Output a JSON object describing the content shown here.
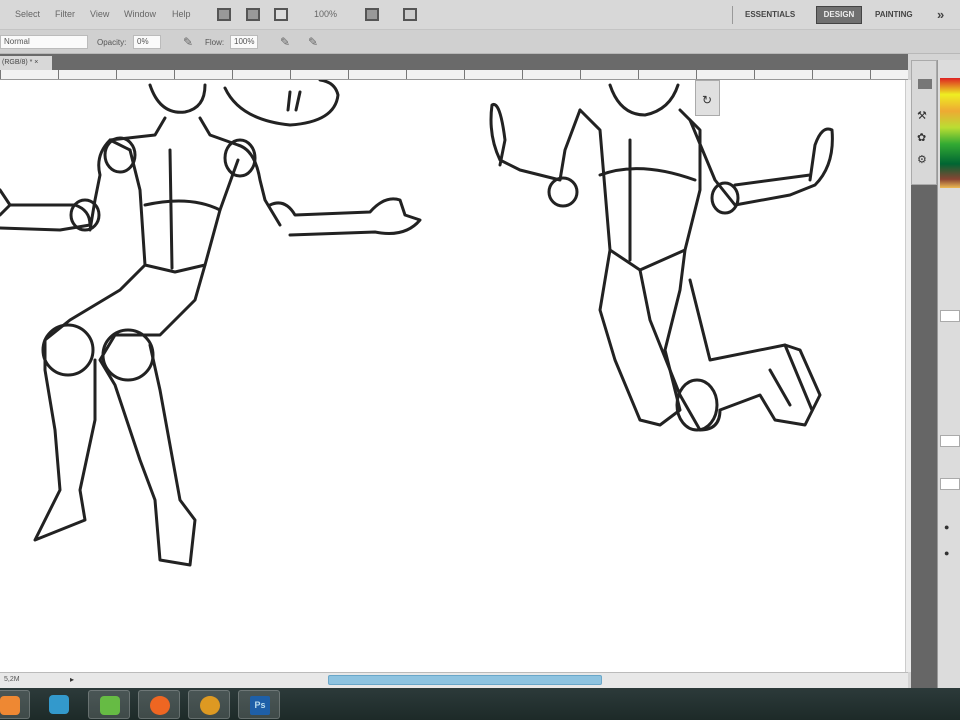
{
  "menubar": {
    "items": [
      "Select",
      "Filter",
      "View",
      "Window",
      "Help"
    ],
    "zoom": "100%",
    "workspaces": {
      "essentials": "ESSENTIALS",
      "design": "DESIGN",
      "painting": "PAINTING",
      "more": "»"
    }
  },
  "options": {
    "mode": "Normal",
    "opacity_label": "Opacity:",
    "opacity": "0%",
    "flow_label": "Flow:",
    "flow": "100%"
  },
  "document": {
    "tab": "(RGB/8) *"
  },
  "status": {
    "doc": "5,2M"
  },
  "taskbar": {
    "apps": [
      "media-player",
      "mail",
      "messenger",
      "firefox",
      "winamp",
      "photoshop"
    ],
    "ps_label": "Ps"
  },
  "colors": {
    "accent": "#8ec3e0",
    "taskbar": "#1d2a28"
  }
}
